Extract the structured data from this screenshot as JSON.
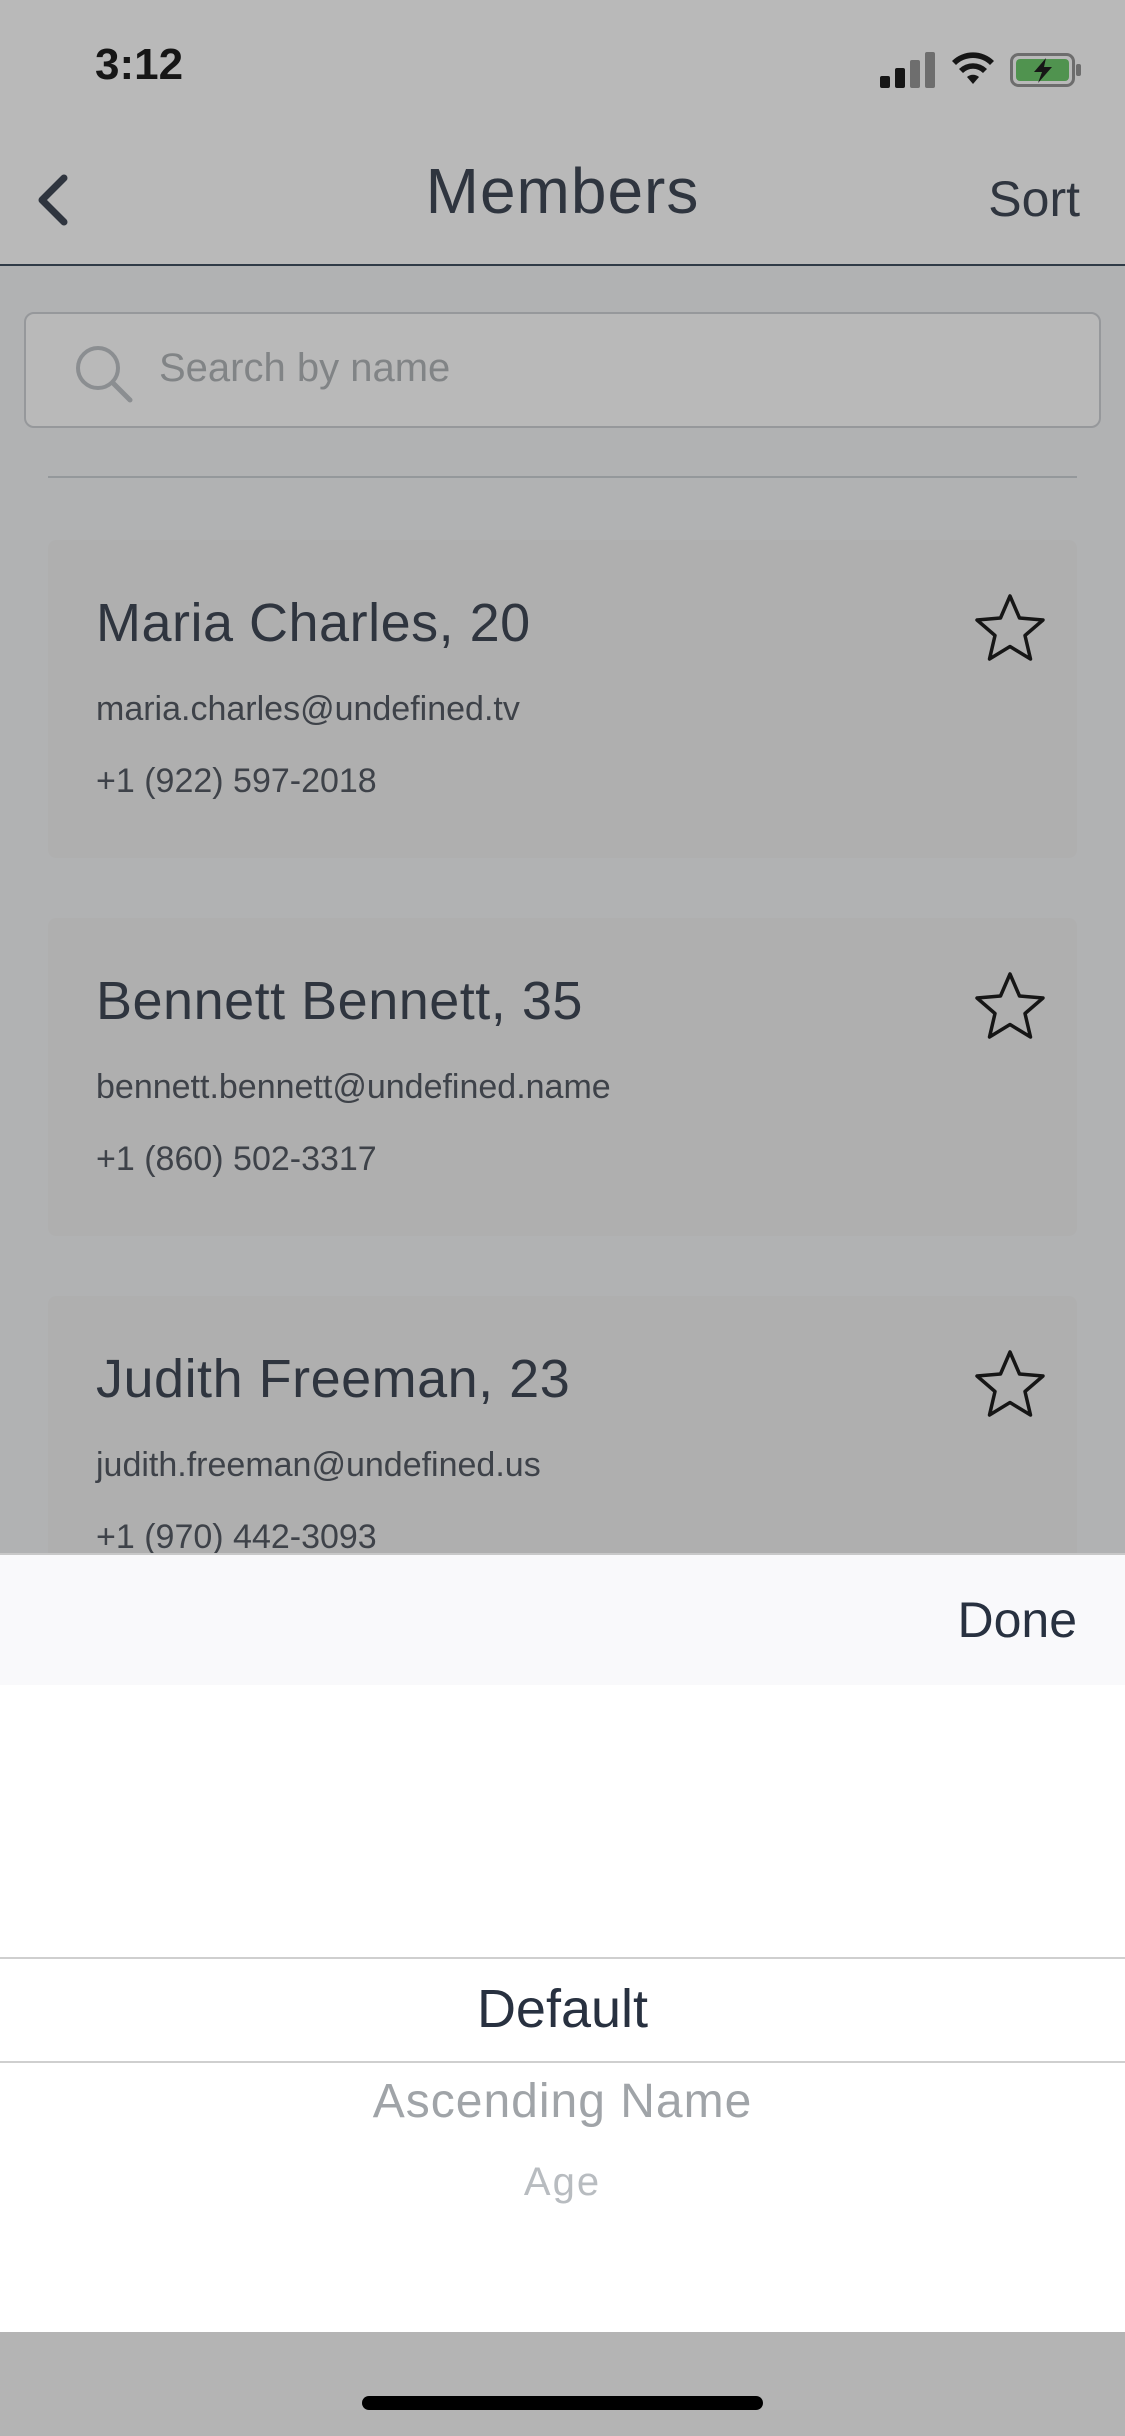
{
  "status_bar": {
    "time": "3:12",
    "signal_icon": "cellular-signal-icon",
    "wifi_icon": "wifi-icon",
    "battery_icon": "battery-charging-icon",
    "battery_color": "#5cc45a"
  },
  "nav": {
    "back_icon": "chevron-left-icon",
    "title": "Members",
    "sort_label": "Sort"
  },
  "search": {
    "icon": "search-icon",
    "placeholder": "Search by name"
  },
  "members": [
    {
      "name": "Maria Charles, 20",
      "email": "maria.charles@undefined.tv",
      "phone": "+1 (922) 597-2018",
      "favorite_icon": "star-outline-icon"
    },
    {
      "name": "Bennett Bennett, 35",
      "email": "bennett.bennett@undefined.name",
      "phone": "+1 (860) 502-3317",
      "favorite_icon": "star-outline-icon"
    },
    {
      "name": "Judith Freeman, 23",
      "email": "judith.freeman@undefined.us",
      "phone": "+1 (970) 442-3093",
      "favorite_icon": "star-outline-icon"
    }
  ],
  "picker": {
    "done_label": "Done",
    "options": [
      "Default",
      "Ascending Name",
      "Age"
    ],
    "selected": "Default"
  },
  "colors": {
    "text_primary": "#283140",
    "overlay": "rgba(60,60,60,0.36)"
  }
}
